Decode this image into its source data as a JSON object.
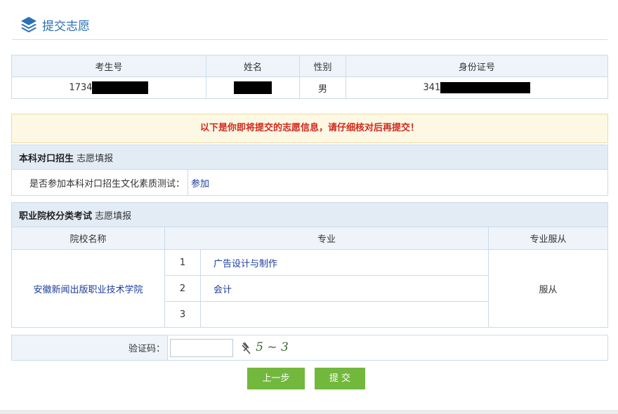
{
  "header": {
    "title": "提交志愿",
    "icon": "layers-icon"
  },
  "applicant": {
    "headers": [
      "考生号",
      "姓名",
      "性别",
      "身份证号"
    ],
    "exam_no_prefix": "1734",
    "gender": "男",
    "id_prefix": "341"
  },
  "notice": "以下是你即将提交的志愿信息，请仔细核对后再提交！",
  "section1": {
    "title_bold": "本科对口招生",
    "title_rest": " 志愿填报",
    "question": "是否参加本科对口招生文化素质测试：",
    "answer": "参加"
  },
  "section2": {
    "title_bold": "职业院校分类考试",
    "title_rest": " 志愿填报",
    "col_school": "院校名称",
    "col_major": "专业",
    "col_obey": "专业服从",
    "school": "安徽新闻出版职业技术学院",
    "majors": [
      {
        "no": "1",
        "name": "广告设计与制作"
      },
      {
        "no": "2",
        "name": "会计"
      },
      {
        "no": "3",
        "name": ""
      }
    ],
    "obey": "服从"
  },
  "captcha": {
    "label": "验证码：",
    "value": "",
    "image_text": "5 ~ 3"
  },
  "buttons": {
    "prev": "上一步",
    "submit": "提 交"
  }
}
